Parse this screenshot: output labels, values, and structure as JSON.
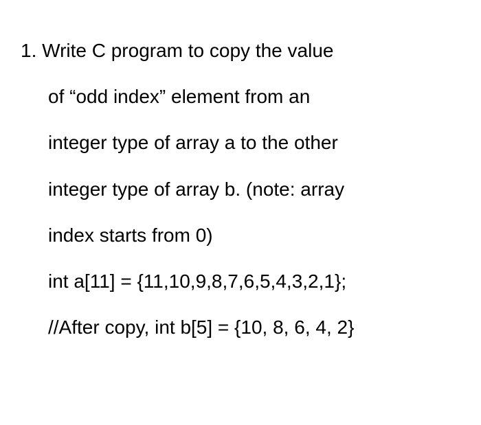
{
  "question": {
    "number": "1.",
    "line1_after_number": "Write C program to copy the value",
    "line2": "of “odd index” element from an",
    "line3": "integer type of array a to the other",
    "line4": "integer type of array b. (note: array",
    "line5": "index starts from 0)",
    "line6": "int a[11] = {11,10,9,8,7,6,5,4,3,2,1};",
    "line7": "//After copy, int b[5] = {10, 8, 6, 4, 2}"
  }
}
